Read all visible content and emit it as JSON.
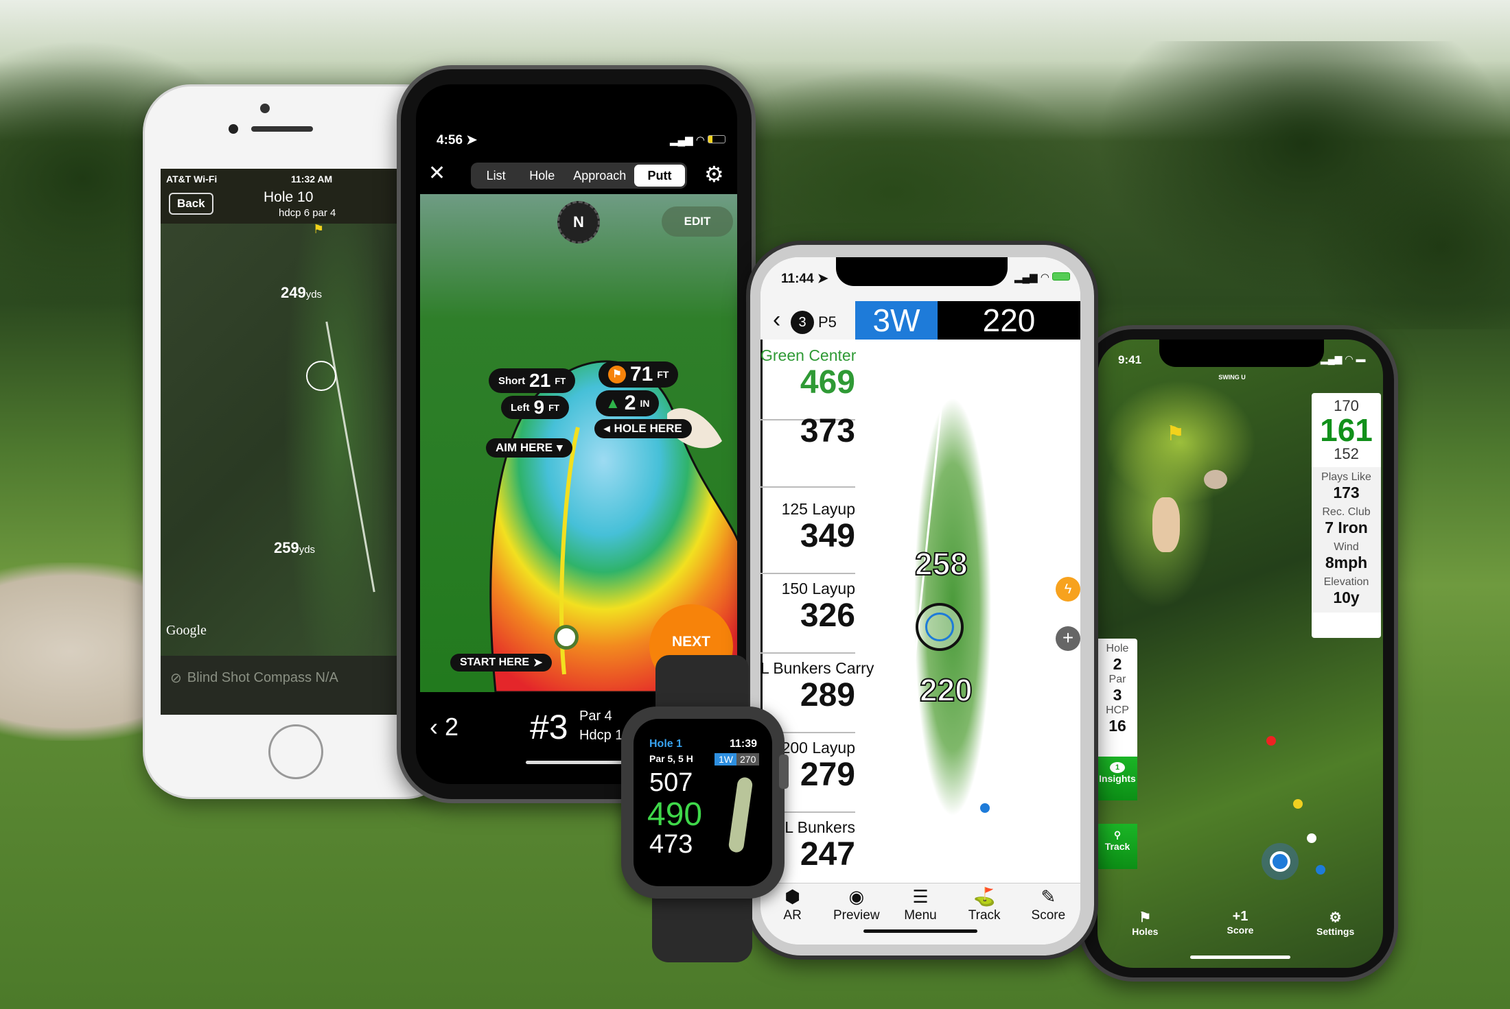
{
  "phone_left": {
    "carrier": "AT&T Wi-Fi",
    "time": "11:32 AM",
    "back_label": "Back",
    "hole_title": "Hole 10",
    "hole_sub": "hdcp 6  par 4",
    "dist1": "249",
    "dist1_unit": "yds",
    "dist2": "259",
    "dist2_unit": "yds",
    "map_credit": "Google",
    "footer": "Blind Shot Compass N/A"
  },
  "phone_putt": {
    "time": "4:56",
    "tabs": [
      {
        "label": "List"
      },
      {
        "label": "Hole"
      },
      {
        "label": "Approach"
      },
      {
        "label": "Putt",
        "active": true
      }
    ],
    "compass": "N",
    "edit_label": "EDIT",
    "flag_dist": "71",
    "flag_unit": "FT",
    "slope": "2",
    "slope_unit": "IN",
    "short_label": "Short",
    "short_val": "21",
    "short_unit": "FT",
    "left_label": "Left",
    "left_val": "9",
    "left_unit": "FT",
    "hole_here": "HOLE HERE",
    "aim_here": "AIM HERE",
    "start_here": "START HERE",
    "next_label": "NEXT",
    "prev_hole": "2",
    "hole_num": "#3",
    "par": "Par 4",
    "hdcp": "Hdcp 1"
  },
  "watch": {
    "hole": "Hole 1",
    "time": "11:39",
    "par_info": "Par 5, 5 H",
    "club": "1W",
    "club_dist": "270",
    "back": "507",
    "center": "490",
    "front": "473"
  },
  "phone_list": {
    "time": "11:44",
    "hole_num": "3",
    "par": "P5",
    "club": "3W",
    "club_dist": "220",
    "rows": [
      {
        "label": "Green Center",
        "value": "469",
        "highlight": true
      },
      {
        "label": "",
        "value": "373"
      },
      {
        "label": "125 Layup",
        "value": "349"
      },
      {
        "label": "150 Layup",
        "value": "326"
      },
      {
        "label": "L Bunkers Carry",
        "value": "289"
      },
      {
        "label": "200 Layup",
        "value": "279"
      },
      {
        "label": "L Bunkers",
        "value": "247"
      }
    ],
    "map_labels": [
      "258",
      "220"
    ],
    "tabs": [
      {
        "label": "AR",
        "icon": "cube-icon"
      },
      {
        "label": "Preview",
        "icon": "eye-icon"
      },
      {
        "label": "Menu",
        "icon": "menu-icon"
      },
      {
        "label": "Track",
        "icon": "driver-icon"
      },
      {
        "label": "Score",
        "icon": "pencil-icon"
      }
    ]
  },
  "phone_swing": {
    "time": "9:41",
    "logo": "SWING U",
    "back": "170",
    "center": "161",
    "front": "152",
    "plays_like_label": "Plays Like",
    "plays_like": "173",
    "rec_club_label": "Rec. Club",
    "rec_club": "7 Iron",
    "wind_label": "Wind",
    "wind": "8mph",
    "elevation_label": "Elevation",
    "elevation": "10y",
    "hole_label": "Hole",
    "hole": "2",
    "par_label": "Par",
    "par": "3",
    "hcp_label": "HCP",
    "hcp": "16",
    "insights_label": "Insights",
    "insights_count": "1",
    "track_label": "Track",
    "nav": [
      {
        "label": "Holes",
        "icon": "flag-icon"
      },
      {
        "label": "Score",
        "icon_text": "+1"
      },
      {
        "label": "Settings",
        "icon": "gear-icon"
      }
    ]
  },
  "colors": {
    "green": "#2f9a35",
    "blue": "#1e7bd9",
    "orange": "#f7830a",
    "swing_green": "#14a21e"
  }
}
